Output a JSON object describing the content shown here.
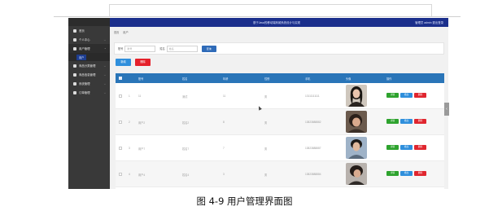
{
  "sidebar": {
    "items": [
      {
        "label": "首页",
        "icon": "home-icon"
      },
      {
        "label": "个人中心",
        "icon": "user-icon"
      },
      {
        "label": "用户管理",
        "icon": "users-icon"
      },
      {
        "label": "商品分类管理",
        "icon": "folder-icon"
      },
      {
        "label": "商品信息管理",
        "icon": "box-icon"
      },
      {
        "label": "系统管理",
        "icon": "gear-icon"
      },
      {
        "label": "订单管理",
        "icon": "grid-icon"
      }
    ],
    "sub_item": "用户"
  },
  "topbar": {
    "title": "基于Java的移动端商城系统设计与实现",
    "user": "管理员 admin  退出登录"
  },
  "breadcrumb": [
    "首页",
    "用户"
  ],
  "search": {
    "label1": "账号",
    "placeholder1": "账号",
    "label2": "姓名",
    "placeholder2": "姓名",
    "button": "查询"
  },
  "actions": {
    "add": "新增",
    "delete": "删除"
  },
  "table": {
    "columns": [
      "",
      "账号",
      "姓名",
      "年龄",
      "性别",
      "手机",
      "头像",
      "操作"
    ],
    "rows": [
      {
        "index": "1",
        "account": "11",
        "name": "测试",
        "age": "11",
        "gender": "男",
        "phone": "13111111111"
      },
      {
        "index": "2",
        "account": "用户2",
        "name": "姓名2",
        "age": "8",
        "gender": "男",
        "phone": "13823888882"
      },
      {
        "index": "3",
        "account": "用户7",
        "name": "姓名7",
        "age": "7",
        "gender": "男",
        "phone": "13823888887"
      },
      {
        "index": "4",
        "account": "用户4",
        "name": "姓名4",
        "age": "3",
        "gender": "男",
        "phone": "13823888884"
      }
    ],
    "op_view": "详情",
    "op_edit": "修改",
    "op_delete": "删除"
  },
  "caption": "图 4-9 用户管理界面图"
}
